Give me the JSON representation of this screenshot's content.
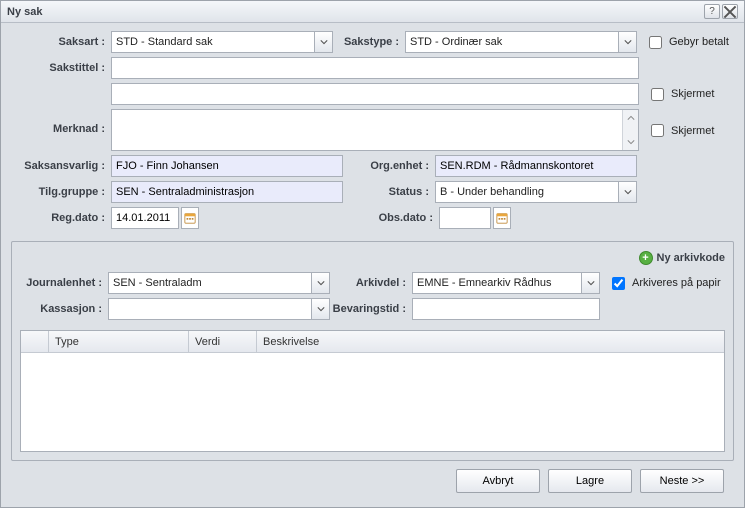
{
  "dialog": {
    "title": "Ny sak"
  },
  "labels": {
    "saksart": "Saksart :",
    "sakstype": "Sakstype :",
    "sakstittel": "Sakstittel :",
    "merknad": "Merknad :",
    "saksansvarlig": "Saksansvarlig :",
    "orgenhet": "Org.enhet :",
    "tilggruppe": "Tilg.gruppe :",
    "status": "Status :",
    "regdato": "Reg.dato :",
    "obsdato": "Obs.dato :",
    "journalenhet": "Journalenhet :",
    "arkivdel": "Arkivdel :",
    "kassasjon": "Kassasjon :",
    "bevaringstid": "Bevaringstid :"
  },
  "values": {
    "saksart": "STD - Standard sak",
    "sakstype": "STD - Ordinær sak",
    "sakstittel": "",
    "sakstittel2": "",
    "merknad": "",
    "saksansvarlig": "FJO - Finn Johansen",
    "orgenhet": "SEN.RDM - Rådmannskontoret",
    "tilggruppe": "SEN - Sentraladministrasjon",
    "status": "B - Under behandling",
    "regdato": "14.01.2011",
    "obsdato": "",
    "journalenhet": "SEN - Sentraladm",
    "arkivdel": "EMNE - Emnearkiv Rådhus",
    "kassasjon": "",
    "bevaringstid": ""
  },
  "checks": {
    "gebyr_betalt": {
      "label": "Gebyr betalt",
      "checked": false
    },
    "skjermet1": {
      "label": "Skjermet",
      "checked": false
    },
    "skjermet2": {
      "label": "Skjermet",
      "checked": false
    },
    "arkiveres_papir": {
      "label": "Arkiveres på papir",
      "checked": true
    }
  },
  "archive": {
    "add_label": "Ny arkivkode"
  },
  "grid": {
    "headers": {
      "type": "Type",
      "verdi": "Verdi",
      "beskrivelse": "Beskrivelse"
    }
  },
  "buttons": {
    "avbryt": "Avbryt",
    "lagre": "Lagre",
    "neste": "Neste >>"
  }
}
